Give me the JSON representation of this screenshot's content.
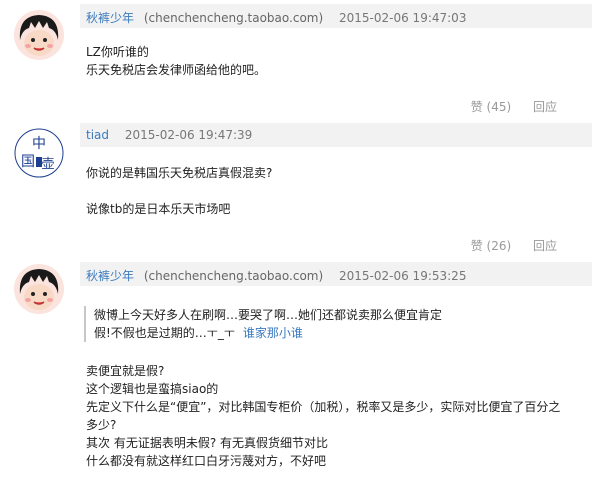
{
  "comments": [
    {
      "author": "秋裤少年",
      "site": "(chenchencheng.taobao.com)",
      "time": "2015-02-06 19:47:03",
      "lines": [
        "LZ你听谁的",
        "乐天免税店会发律师函给他的吧。"
      ],
      "like": "赞 (45)",
      "reply": "回应"
    },
    {
      "author": "tiad",
      "time": "2015-02-06 19:47:39",
      "lines": [
        "你说的是韩国乐天免税店真假混卖?",
        "说像tb的是日本乐天市场吧"
      ],
      "like": "赞 (26)",
      "reply": "回应"
    },
    {
      "author": "秋裤少年",
      "site": "(chenchencheng.taobao.com)",
      "time": "2015-02-06 19:53:25",
      "quote": {
        "line1": "微博上今天好多人在刷啊…要哭了啊…她们还都说卖那么便宜肯定",
        "line2": "假!不假也是过期的…ㅜ_ㅜ",
        "who": "谁家那小谁"
      },
      "lines": [
        "卖便宜就是假?",
        "这个逻辑也是蛮搞siao的",
        "先定义下什么是“便宜”，对比韩国专柜价（加税），税率又是多少，实际对比便宜了百分之",
        "多少?",
        "其次 有无证据表明未假? 有无真假货细节对比",
        "什么都没有就这样红口白牙污蔑对方，不好吧"
      ]
    }
  ]
}
